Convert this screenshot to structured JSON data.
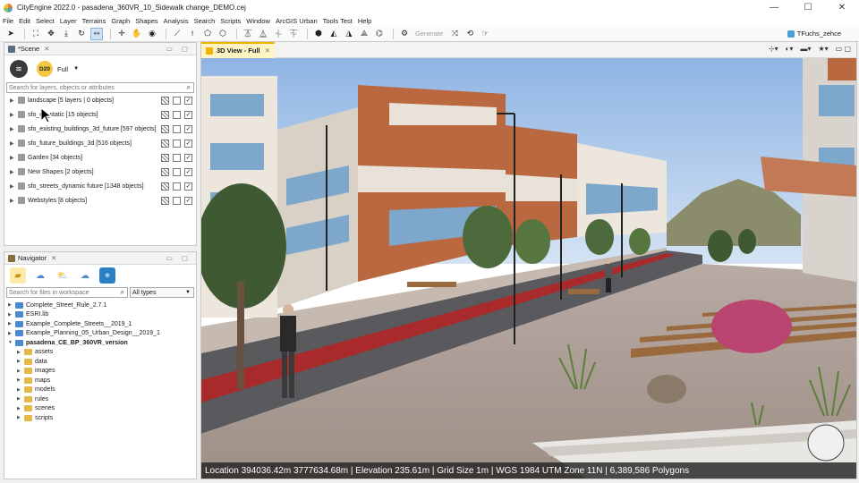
{
  "window": {
    "title": "CityEngine 2022.0 - pasadena_360VR_10_Sidewalk change_DEMO.cej",
    "controls": [
      "—",
      "☐",
      "✕"
    ]
  },
  "menu": [
    "File",
    "Edit",
    "Select",
    "Layer",
    "Terrains",
    "Graph",
    "Shapes",
    "Analysis",
    "Search",
    "Scripts",
    "Window",
    "ArcGIS Urban",
    "Tools Test",
    "Help"
  ],
  "toolbar": {
    "generate_label": "Generate",
    "user": "TFuchs_zehce"
  },
  "scene_panel": {
    "tab_label": "*Scene",
    "d20_label": "D20",
    "mode_label": "Full",
    "search_placeholder": "Search for layers, objects or attributes",
    "layers": [
      {
        "label": "landscape [5 layers | 0 objects]"
      },
      {
        "label": "sfo_ex_static [15 objects]"
      },
      {
        "label": "sfo_existing_buildings_3d_future [597 objects]"
      },
      {
        "label": "sfo_future_buildings_3d [516 objects]"
      },
      {
        "label": "Garden [34 objects]"
      },
      {
        "label": "New Shapes [2 objects]"
      },
      {
        "label": "sfo_streets_dynamic future [1348 objects]"
      },
      {
        "label": "Webstyles [8 objects]"
      }
    ]
  },
  "navigator_panel": {
    "tab_label": "Navigator",
    "search_placeholder": "Search for files in workspace",
    "type_filter": "All types",
    "tree": [
      {
        "label": "Complete_Street_Rule_2.7.1",
        "kind": "proj",
        "indent": 0,
        "open": false
      },
      {
        "label": "ESRI.lib",
        "kind": "proj",
        "indent": 0,
        "open": false
      },
      {
        "label": "Example_Complete_Streets__2019_1",
        "kind": "proj",
        "indent": 0,
        "open": false
      },
      {
        "label": "Example_Planning_05_Urban_Design__2019_1",
        "kind": "proj",
        "indent": 0,
        "open": false
      },
      {
        "label": "pasadena_CE_BP_360VR_version",
        "kind": "proj",
        "indent": 0,
        "open": true,
        "bold": true
      },
      {
        "label": "assets",
        "kind": "folder",
        "indent": 1,
        "open": false
      },
      {
        "label": "data",
        "kind": "folder",
        "indent": 1,
        "open": false
      },
      {
        "label": "images",
        "kind": "folder",
        "indent": 1,
        "open": false
      },
      {
        "label": "maps",
        "kind": "folder",
        "indent": 1,
        "open": false
      },
      {
        "label": "models",
        "kind": "folder",
        "indent": 1,
        "open": false
      },
      {
        "label": "rules",
        "kind": "folder",
        "indent": 1,
        "open": false
      },
      {
        "label": "scenes",
        "kind": "folder",
        "indent": 1,
        "open": false
      },
      {
        "label": "scripts",
        "kind": "folder",
        "indent": 1,
        "open": false
      }
    ]
  },
  "viewport": {
    "tab_label": "3D View - Full",
    "status": "Location 394036.42m 3777634.68m  |  Elevation 235.61m  |  Grid Size 1m  |  WGS 1984 UTM Zone 11N  |  6,389,586 Polygons"
  },
  "colors": {
    "accent": "#f0b400",
    "bike_lane": "#a92a2a",
    "sky": "#a9c7ec"
  }
}
